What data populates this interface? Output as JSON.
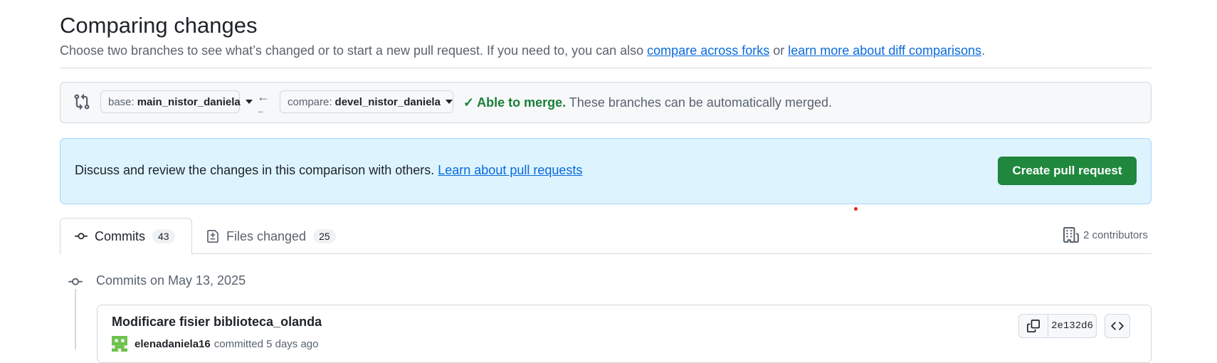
{
  "header": {
    "title": "Comparing changes",
    "subtitle_pre": "Choose two branches to see what’s changed or to start a new pull request. If you need to, you can also ",
    "link_forks": "compare across forks",
    "subtitle_mid": " or ",
    "link_learn": "learn more about diff comparisons",
    "subtitle_end": "."
  },
  "compare": {
    "base_prefix": "base:",
    "base_value": "main_nistor_daniela",
    "compare_prefix": "compare:",
    "compare_value": "devel_nistor_daniela",
    "arrow": "←",
    "dots": "...",
    "status_icon": "check-icon",
    "status_strong": "Able to merge.",
    "status_text": " These branches can be automatically merged."
  },
  "flash": {
    "text": "Discuss and review the changes in this comparison with others. ",
    "link": "Learn about pull requests",
    "button": "Create pull request"
  },
  "tabs": [
    {
      "label": "Commits",
      "count": "43",
      "icon": "git-commit-icon",
      "selected": true
    },
    {
      "label": "Files changed",
      "count": "25",
      "icon": "file-diff-icon",
      "selected": false
    }
  ],
  "contributors": "2 contributors",
  "timeline": {
    "heading": "Commits on May 13, 2025",
    "commits": [
      {
        "title": "Modificare fisier biblioteca_olanda",
        "author": "elenadaniela16",
        "meta": "committed 5 days ago",
        "sha": "2e132d6"
      }
    ]
  },
  "colors": {
    "success": "#1a7f37",
    "primary_button": "#1f883d",
    "link": "#0969da",
    "flash_bg": "#ddf4ff"
  }
}
